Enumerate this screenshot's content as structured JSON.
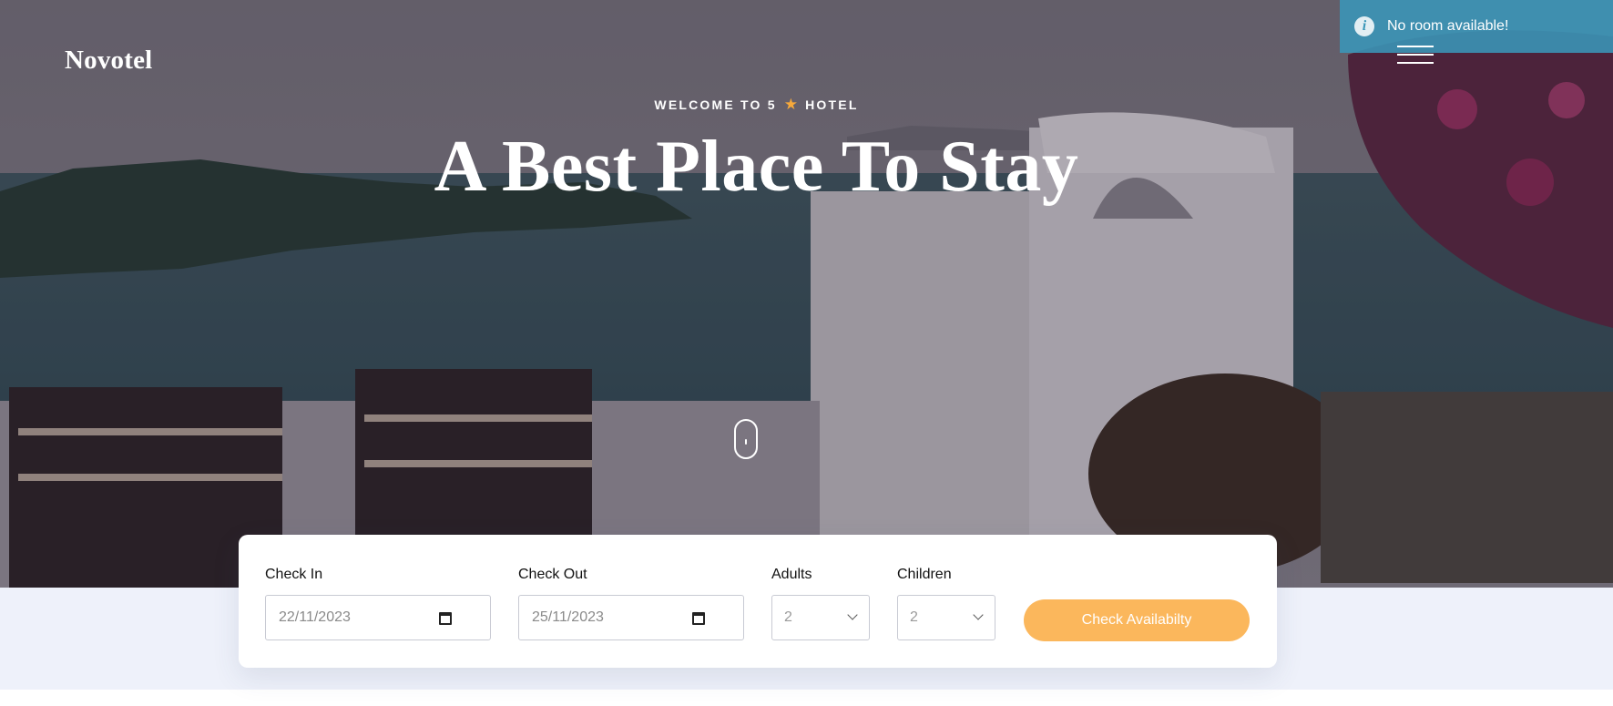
{
  "brand": {
    "logo_text": "Novotel"
  },
  "notification": {
    "message": "No room available!",
    "icon": "info-icon"
  },
  "nav": {
    "menu_icon": "hamburger-icon"
  },
  "hero": {
    "eyebrow_prefix": "WELCOME TO 5",
    "eyebrow_star": "★",
    "eyebrow_suffix": "HOTEL",
    "title": "A Best Place To Stay",
    "scroll_icon": "mouse-scroll-icon"
  },
  "booking": {
    "check_in": {
      "label": "Check In",
      "value": "22/11/2023",
      "icon": "calendar-icon"
    },
    "check_out": {
      "label": "Check Out",
      "value": "25/11/2023",
      "icon": "calendar-icon"
    },
    "adults": {
      "label": "Adults",
      "value": "2",
      "icon": "chevron-down-icon"
    },
    "children": {
      "label": "Children",
      "value": "2",
      "icon": "chevron-down-icon"
    },
    "submit_label": "Check Availabilty"
  },
  "colors": {
    "accent": "#fbb75c",
    "star": "#f6a93b",
    "toast": "#3a96b8",
    "section_bg": "#eef1fa"
  }
}
